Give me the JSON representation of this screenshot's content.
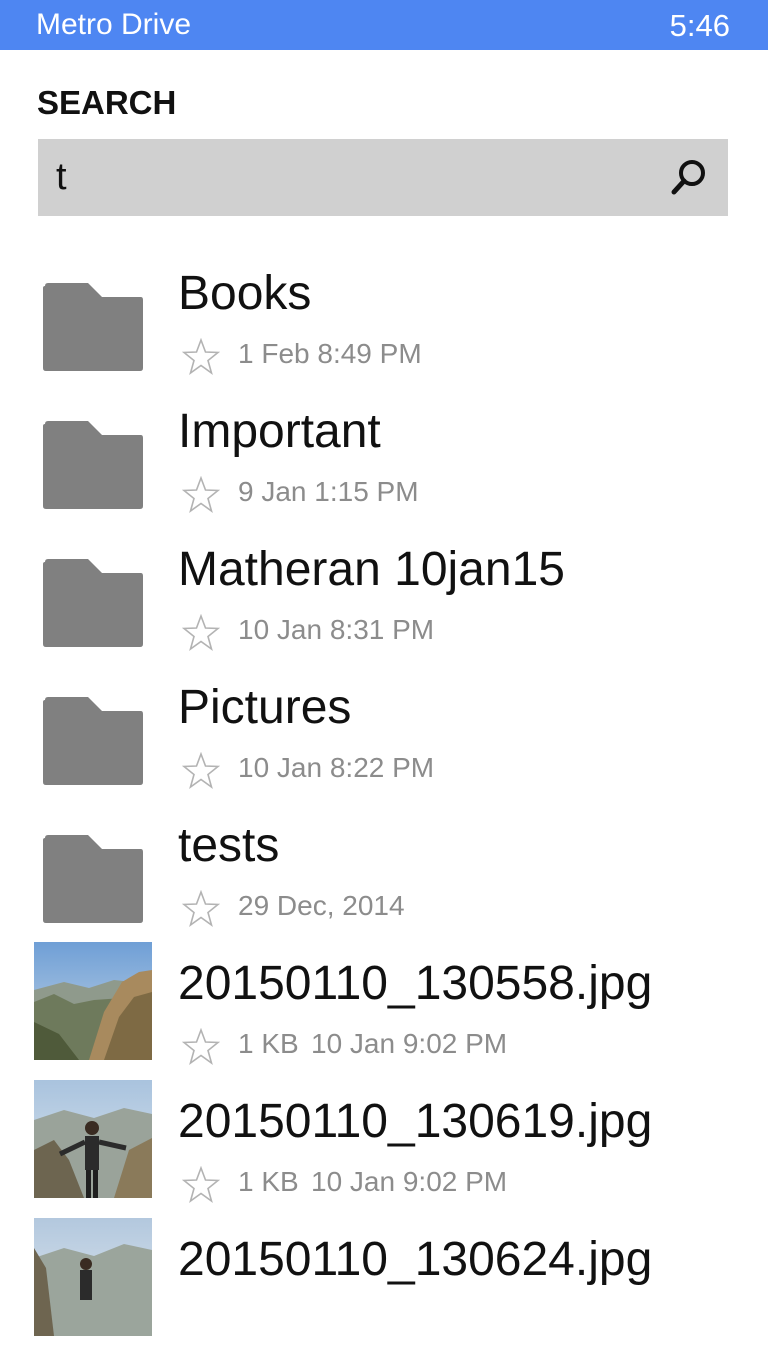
{
  "status_bar": {
    "app_title": "Metro Drive",
    "time": "5:46"
  },
  "search": {
    "title": "SEARCH",
    "query": "t"
  },
  "items": [
    {
      "type": "folder",
      "name": "Books",
      "date": "1 Feb 8:49 PM"
    },
    {
      "type": "folder",
      "name": "Important",
      "date": "9 Jan 1:15 PM"
    },
    {
      "type": "folder",
      "name": "Matheran 10jan15",
      "date": "10 Jan 8:31 PM"
    },
    {
      "type": "folder",
      "name": "Pictures",
      "date": "10 Jan 8:22 PM"
    },
    {
      "type": "folder",
      "name": "tests",
      "date": "29 Dec, 2014"
    },
    {
      "type": "photo",
      "name": "20150110_130558.jpg",
      "size": "1 KB",
      "date": "10 Jan 9:02 PM"
    },
    {
      "type": "photo",
      "name": "20150110_130619.jpg",
      "size": "1 KB",
      "date": "10 Jan 9:02 PM"
    },
    {
      "type": "photo",
      "name": "20150110_130624.jpg"
    }
  ],
  "colors": {
    "accent": "#4e86f2",
    "folder": "#808080",
    "search_background": "#d0d0d0",
    "meta_text": "#8c8c8c"
  }
}
